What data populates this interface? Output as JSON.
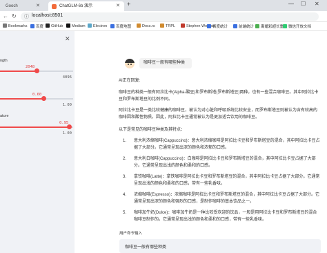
{
  "browser": {
    "tabs": [
      {
        "label": "Gooch"
      },
      {
        "label": "ChatGLM-6b 演示"
      }
    ],
    "url": "localhost:8501",
    "bookmarks": [
      {
        "label": "Bookmarks",
        "color": "#777777"
      },
      {
        "label": "百度",
        "color": "#3a6fe0"
      },
      {
        "label": "GitHub",
        "color": "#222222"
      },
      {
        "label": "Medium",
        "color": "#111111"
      },
      {
        "label": "Electron",
        "color": "#5aa6c8"
      },
      {
        "label": "百度地图",
        "color": "#3a6fe0"
      },
      {
        "label": "Docs.rs",
        "color": "#d08a2e"
      },
      {
        "label": "TRPL",
        "color": "#d08a2e"
      },
      {
        "label": "Stephen Wolfram",
        "color": "#c0392b"
      },
      {
        "label": "百度统计",
        "color": "#3a6fe0"
      },
      {
        "label": "前端统计",
        "color": "#3a6fe0"
      },
      {
        "label": "离婚彩超长重案",
        "color": "#4caf50"
      },
      {
        "label": "微信开放文档",
        "color": "#2ecc71"
      }
    ]
  },
  "sidebar": {
    "sliders": [
      {
        "label": "ngth",
        "value": "2048",
        "max": "4096",
        "fraction": 0.5
      },
      {
        "label": "",
        "value": "0.60",
        "max": "1.00",
        "fraction": 0.6
      },
      {
        "label": "ature",
        "value": "0.95",
        "max": "1.00",
        "fraction": 0.95
      }
    ]
  },
  "chat": {
    "user_message": "咖啡豆一般有哪些种类",
    "ai_prefix": "AI正在回复:",
    "para1": "咖啡豆的种类一般有阿拉比卡(Alpha-酸豆)和罗布斯塔(罗布斯塔豆)两种，也有一些混合咖啡豆。其中阿拉比卡豆和罗布斯塔豆的比例不同。",
    "para2": "阿拉比卡豆是一类比较健康的咖啡豆，被认为对心脏和呼吸系统比较安全，而罗布斯塔豆则被认为含有较高的咖啡因和酸性物质。因此，阿拉比卡豆通常被认为是更加适合饮用的咖啡豆。",
    "list_intro": "以下是常见的咖啡豆种类及其特点：",
    "items": [
      {
        "num": "1.",
        "text": "意大利浓缩咖啡(Cappuccino)：意大利浓缩咖啡是阿拉比卡豆和罗布斯塔豆的混合，其中阿拉比卡豆占据了大部分。它通常呈现出深的颜色和浓郁的口感。"
      },
      {
        "num": "2.",
        "text": "意大利白咖啡(Cappuccino)：白咖啡是阿拉比卡豆和罗布斯塔豆的混合，其中阿拉比卡豆占据了大部分。它通常呈现出浅的颜色和柔和的口感。"
      },
      {
        "num": "3.",
        "text": "拿铁咖啡(Latte)：拿铁咖啡是阿拉比卡豆和罗布斯塔豆的混合，其中阿拉比卡豆占据了大部分。它通常呈现出浅的颜色和柔和的口感，带有一些乳香味。"
      },
      {
        "num": "4.",
        "text": "浓缩咖啡(Espresso)：浓缩咖啡是阿拉比卡豆和罗布斯塔豆的混合，其中阿拉比卡豆占据了大部分。它通常呈现出深的颜色和强烈的口感，是制作咖啡的基本饮品之一。"
      },
      {
        "num": "5.",
        "text": "咖啡加牛奶(Dulce)：咖啡加牛奶是一种比较受欢迎的饮品，一般是用阿拉比卡豆和罗布斯塔豆的混合咖啡豆制作的。它通常呈现出浅的颜色和柔和的口感，带有一些乳香味。"
      }
    ],
    "input_label": "用户命令输入",
    "input_value": "咖啡豆一般有哪些种类"
  },
  "colors": {
    "accent": "#f04a4a",
    "sidebar_bg": "#f0f2f6"
  }
}
